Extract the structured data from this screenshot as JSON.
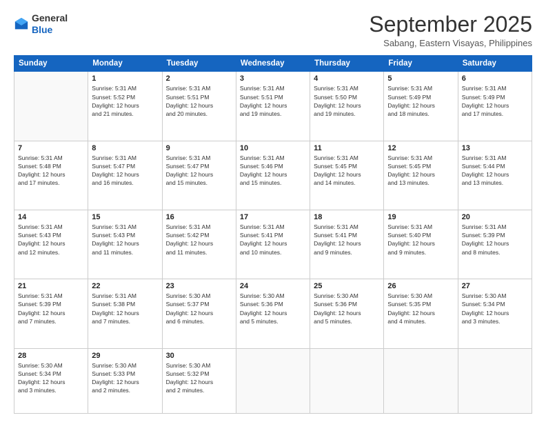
{
  "logo": {
    "general": "General",
    "blue": "Blue"
  },
  "header": {
    "month": "September 2025",
    "location": "Sabang, Eastern Visayas, Philippines"
  },
  "weekdays": [
    "Sunday",
    "Monday",
    "Tuesday",
    "Wednesday",
    "Thursday",
    "Friday",
    "Saturday"
  ],
  "weeks": [
    [
      {
        "day": "",
        "info": ""
      },
      {
        "day": "1",
        "info": "Sunrise: 5:31 AM\nSunset: 5:52 PM\nDaylight: 12 hours\nand 21 minutes."
      },
      {
        "day": "2",
        "info": "Sunrise: 5:31 AM\nSunset: 5:51 PM\nDaylight: 12 hours\nand 20 minutes."
      },
      {
        "day": "3",
        "info": "Sunrise: 5:31 AM\nSunset: 5:51 PM\nDaylight: 12 hours\nand 19 minutes."
      },
      {
        "day": "4",
        "info": "Sunrise: 5:31 AM\nSunset: 5:50 PM\nDaylight: 12 hours\nand 19 minutes."
      },
      {
        "day": "5",
        "info": "Sunrise: 5:31 AM\nSunset: 5:49 PM\nDaylight: 12 hours\nand 18 minutes."
      },
      {
        "day": "6",
        "info": "Sunrise: 5:31 AM\nSunset: 5:49 PM\nDaylight: 12 hours\nand 17 minutes."
      }
    ],
    [
      {
        "day": "7",
        "info": "Sunrise: 5:31 AM\nSunset: 5:48 PM\nDaylight: 12 hours\nand 17 minutes."
      },
      {
        "day": "8",
        "info": "Sunrise: 5:31 AM\nSunset: 5:47 PM\nDaylight: 12 hours\nand 16 minutes."
      },
      {
        "day": "9",
        "info": "Sunrise: 5:31 AM\nSunset: 5:47 PM\nDaylight: 12 hours\nand 15 minutes."
      },
      {
        "day": "10",
        "info": "Sunrise: 5:31 AM\nSunset: 5:46 PM\nDaylight: 12 hours\nand 15 minutes."
      },
      {
        "day": "11",
        "info": "Sunrise: 5:31 AM\nSunset: 5:45 PM\nDaylight: 12 hours\nand 14 minutes."
      },
      {
        "day": "12",
        "info": "Sunrise: 5:31 AM\nSunset: 5:45 PM\nDaylight: 12 hours\nand 13 minutes."
      },
      {
        "day": "13",
        "info": "Sunrise: 5:31 AM\nSunset: 5:44 PM\nDaylight: 12 hours\nand 13 minutes."
      }
    ],
    [
      {
        "day": "14",
        "info": "Sunrise: 5:31 AM\nSunset: 5:43 PM\nDaylight: 12 hours\nand 12 minutes."
      },
      {
        "day": "15",
        "info": "Sunrise: 5:31 AM\nSunset: 5:43 PM\nDaylight: 12 hours\nand 11 minutes."
      },
      {
        "day": "16",
        "info": "Sunrise: 5:31 AM\nSunset: 5:42 PM\nDaylight: 12 hours\nand 11 minutes."
      },
      {
        "day": "17",
        "info": "Sunrise: 5:31 AM\nSunset: 5:41 PM\nDaylight: 12 hours\nand 10 minutes."
      },
      {
        "day": "18",
        "info": "Sunrise: 5:31 AM\nSunset: 5:41 PM\nDaylight: 12 hours\nand 9 minutes."
      },
      {
        "day": "19",
        "info": "Sunrise: 5:31 AM\nSunset: 5:40 PM\nDaylight: 12 hours\nand 9 minutes."
      },
      {
        "day": "20",
        "info": "Sunrise: 5:31 AM\nSunset: 5:39 PM\nDaylight: 12 hours\nand 8 minutes."
      }
    ],
    [
      {
        "day": "21",
        "info": "Sunrise: 5:31 AM\nSunset: 5:39 PM\nDaylight: 12 hours\nand 7 minutes."
      },
      {
        "day": "22",
        "info": "Sunrise: 5:31 AM\nSunset: 5:38 PM\nDaylight: 12 hours\nand 7 minutes."
      },
      {
        "day": "23",
        "info": "Sunrise: 5:30 AM\nSunset: 5:37 PM\nDaylight: 12 hours\nand 6 minutes."
      },
      {
        "day": "24",
        "info": "Sunrise: 5:30 AM\nSunset: 5:36 PM\nDaylight: 12 hours\nand 5 minutes."
      },
      {
        "day": "25",
        "info": "Sunrise: 5:30 AM\nSunset: 5:36 PM\nDaylight: 12 hours\nand 5 minutes."
      },
      {
        "day": "26",
        "info": "Sunrise: 5:30 AM\nSunset: 5:35 PM\nDaylight: 12 hours\nand 4 minutes."
      },
      {
        "day": "27",
        "info": "Sunrise: 5:30 AM\nSunset: 5:34 PM\nDaylight: 12 hours\nand 3 minutes."
      }
    ],
    [
      {
        "day": "28",
        "info": "Sunrise: 5:30 AM\nSunset: 5:34 PM\nDaylight: 12 hours\nand 3 minutes."
      },
      {
        "day": "29",
        "info": "Sunrise: 5:30 AM\nSunset: 5:33 PM\nDaylight: 12 hours\nand 2 minutes."
      },
      {
        "day": "30",
        "info": "Sunrise: 5:30 AM\nSunset: 5:32 PM\nDaylight: 12 hours\nand 2 minutes."
      },
      {
        "day": "",
        "info": ""
      },
      {
        "day": "",
        "info": ""
      },
      {
        "day": "",
        "info": ""
      },
      {
        "day": "",
        "info": ""
      }
    ]
  ]
}
